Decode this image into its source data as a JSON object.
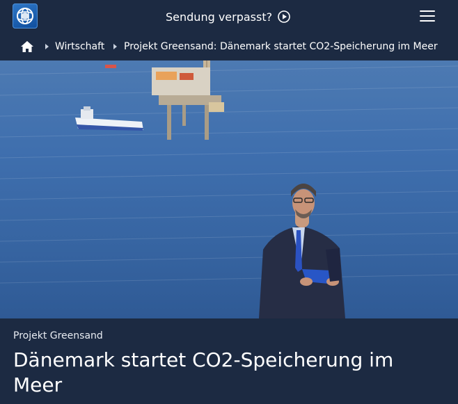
{
  "header": {
    "logo_icon": "tagesschau-logo-icon",
    "sendung_label": "Sendung verpasst?",
    "play_icon": "play-circle-icon",
    "menu_icon": "hamburger-menu-icon"
  },
  "breadcrumb": {
    "home_icon": "home-icon",
    "items": [
      {
        "label": "Wirtschaft"
      },
      {
        "label": "Projekt Greensand: Dänemark startet CO2-Speicherung im Meer"
      }
    ]
  },
  "article": {
    "kicker": "Projekt Greensand",
    "headline": "Dänemark startet CO2-Speicherung im Meer"
  },
  "colors": {
    "background": "#1c2a42",
    "logo_blue": "#1f63b5",
    "sea": "#3a68a6"
  }
}
